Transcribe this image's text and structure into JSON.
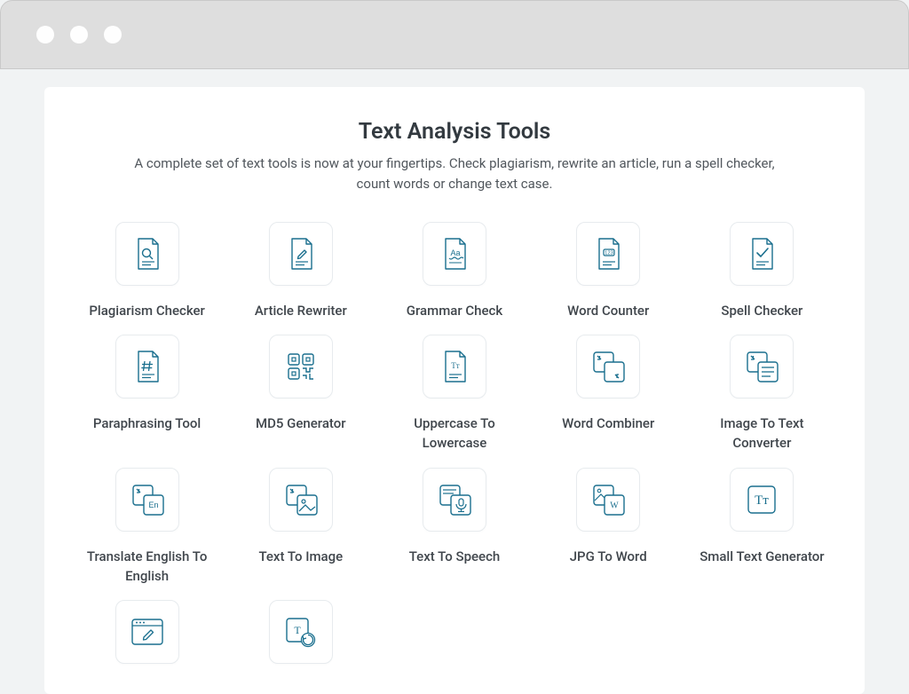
{
  "header": {
    "title": "Text Analysis Tools",
    "subtitle": "A complete set of text tools is now at your fingertips. Check plagiarism, rewrite an article, run a spell checker, count words or change text case."
  },
  "tools": [
    {
      "label": "Plagiarism Checker",
      "icon": "file-search-icon"
    },
    {
      "label": "Article Rewriter",
      "icon": "file-pencil-icon"
    },
    {
      "label": "Grammar Check",
      "icon": "file-aa-icon"
    },
    {
      "label": "Word Counter",
      "icon": "file-123-icon"
    },
    {
      "label": "Spell Checker",
      "icon": "file-check-icon"
    },
    {
      "label": "Paraphrasing Tool",
      "icon": "file-hash-icon"
    },
    {
      "label": "MD5 Generator",
      "icon": "qr-icon"
    },
    {
      "label": "Uppercase To Lowercase",
      "icon": "file-tt-icon"
    },
    {
      "label": "Word Combiner",
      "icon": "file-combine-icon"
    },
    {
      "label": "Image To Text Converter",
      "icon": "image-to-text-icon"
    },
    {
      "label": "Translate English To English",
      "icon": "file-en-icon"
    },
    {
      "label": "Text To Image",
      "icon": "text-to-image-icon"
    },
    {
      "label": "Text To Speech",
      "icon": "file-mic-icon"
    },
    {
      "label": "JPG To Word",
      "icon": "jpg-to-word-icon"
    },
    {
      "label": "Small Text Generator",
      "icon": "tt-box-icon"
    },
    {
      "label": "",
      "icon": "browser-pencil-icon"
    },
    {
      "label": "",
      "icon": "text-refresh-icon"
    }
  ],
  "colors": {
    "icon_stroke": "#1a6f8e"
  }
}
